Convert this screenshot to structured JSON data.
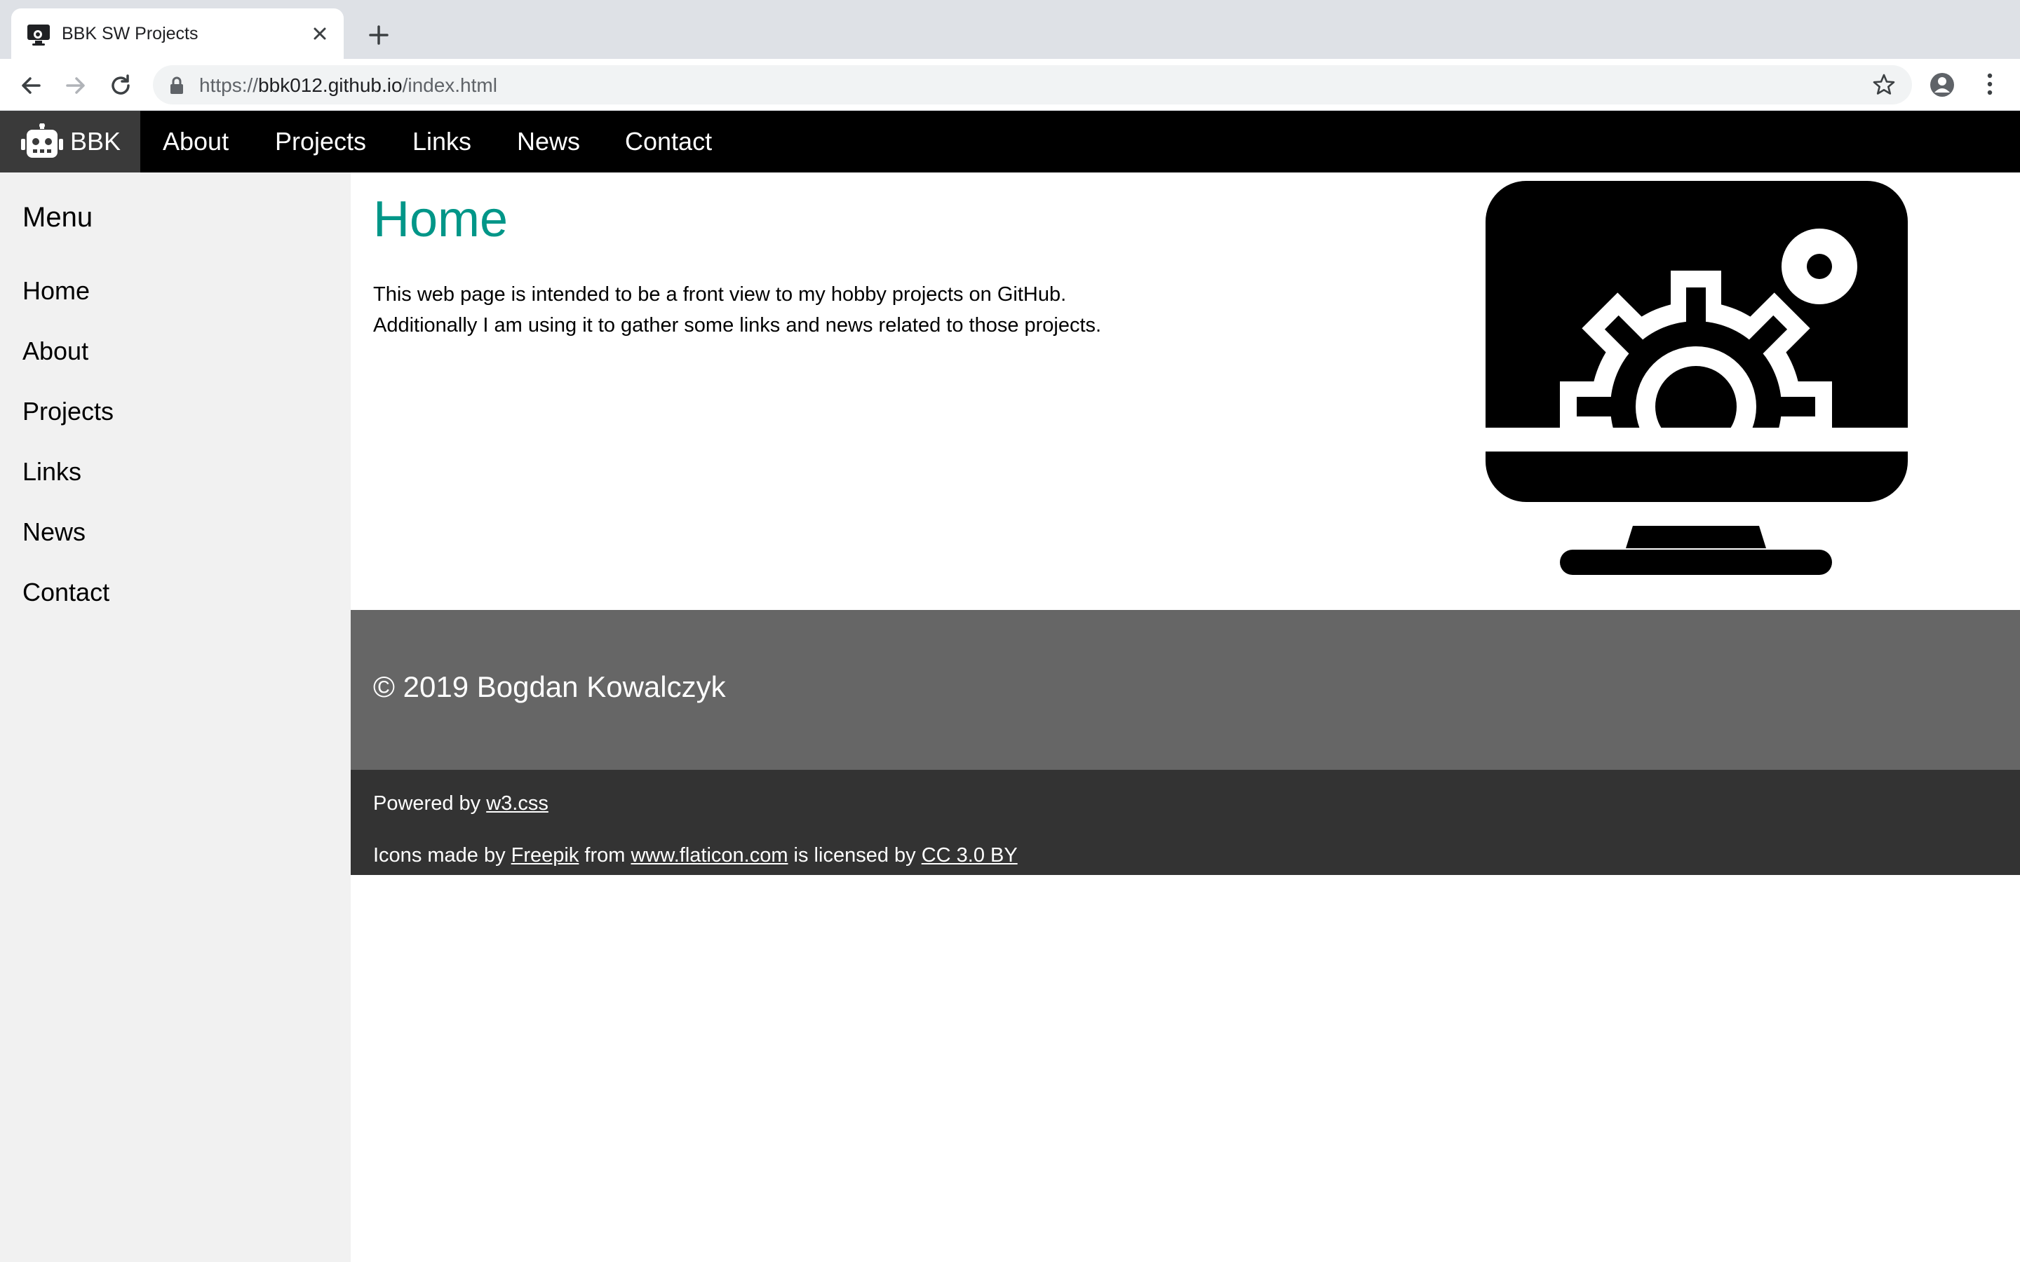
{
  "browser": {
    "tab_title": "BBK SW Projects",
    "url_scheme": "https://",
    "url_host": "bbk012.github.io",
    "url_path": "/index.html"
  },
  "topnav": {
    "brand": "BBK",
    "items": [
      "About",
      "Projects",
      "Links",
      "News",
      "Contact"
    ]
  },
  "sidebar": {
    "title": "Menu",
    "items": [
      "Home",
      "About",
      "Projects",
      "Links",
      "News",
      "Contact"
    ]
  },
  "main": {
    "title": "Home",
    "intro_line1": "This web page is intended to be a front view to my hobby projects on GitHub.",
    "intro_line2": "Additionally I am using it to gather some links and news related to those projects."
  },
  "footer": {
    "copyright": "© 2019 Bogdan Kowalczyk",
    "powered_prefix": "Powered by ",
    "powered_link": "w3.css",
    "icons_prefix": "Icons made by ",
    "icons_author": "Freepik",
    "icons_from": " from ",
    "icons_site": "www.flaticon.com",
    "icons_licensed": " is licensed by ",
    "icons_license": "CC 3.0 BY"
  },
  "colors": {
    "accent": "#009688",
    "nav_bg": "#000000",
    "brand_bg": "#3a3a3a",
    "sidebar_bg": "#f1f1f1",
    "footer_top_bg": "#666666",
    "footer_bottom_bg": "#333333"
  },
  "icons": {
    "brand": "robot-icon",
    "hero": "monitor-gear-icon"
  }
}
